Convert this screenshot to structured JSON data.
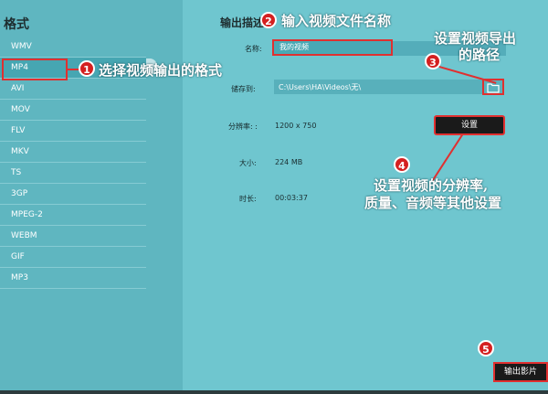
{
  "sidebar": {
    "title": "格式",
    "formats": [
      "WMV",
      "MP4",
      "AVI",
      "MOV",
      "FLV",
      "MKV",
      "TS",
      "3GP",
      "MPEG-2",
      "WEBM",
      "GIF",
      "MP3"
    ],
    "selected": "MP4"
  },
  "main": {
    "title": "输出描述",
    "name_label": "名称:",
    "name_value": "我的视频",
    "save_label": "储存到:",
    "save_path": "C:\\Users\\HA\\Videos\\无\\",
    "resolution_label": "分辨率: :",
    "resolution_value": "1200 x 750",
    "settings_button": "设置",
    "size_label": "大小:",
    "size_value": "224 MB",
    "duration_label": "时长:",
    "duration_value": "00:03:37",
    "export_button": "输出影片"
  },
  "annotations": {
    "a1": {
      "num": "1",
      "text": "选择视频输出的格式"
    },
    "a2": {
      "num": "2",
      "text": "输入视频文件名称"
    },
    "a3": {
      "num": "3",
      "line1": "设置视频导出",
      "line2": "的路径"
    },
    "a4": {
      "num": "4",
      "line1": "设置视频的分辨率,",
      "line2": "质量、音频等其他设置"
    },
    "a5": {
      "num": "5"
    }
  },
  "icons": {
    "folder": "folder-icon"
  },
  "colors": {
    "accent_red": "#e03030",
    "panel": "#6fc6cf",
    "sidebar": "#5fb6c0"
  }
}
